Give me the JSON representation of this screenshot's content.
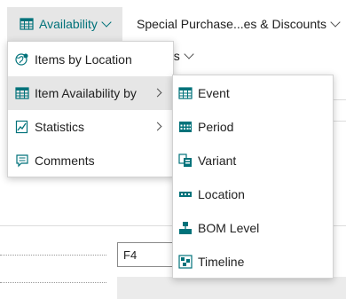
{
  "colors": {
    "accent": "#00727a",
    "menu_highlight": "#e6e6e6",
    "icon": "#00727a"
  },
  "action_bar": {
    "availability_label": "Availability",
    "availability_icon": "grid-table-icon",
    "special_label": "Special Purchase...es & Discounts",
    "hidden_fragment": "es"
  },
  "availability_menu": {
    "items": [
      {
        "label": "Items by Location",
        "icon": "globe-location-icon"
      },
      {
        "label": "Item Availability by",
        "icon": "grid-table-icon",
        "has_submenu": true
      },
      {
        "label": "Statistics",
        "icon": "statistics-chart-icon",
        "has_submenu": true
      },
      {
        "label": "Comments",
        "icon": "comment-icon"
      }
    ]
  },
  "availability_by_submenu": {
    "items": [
      {
        "label": "Event",
        "icon": "grid-table-icon"
      },
      {
        "label": "Period",
        "icon": "calendar-grid-icon"
      },
      {
        "label": "Variant",
        "icon": "variant-icon"
      },
      {
        "label": "Location",
        "icon": "location-bar-icon"
      },
      {
        "label": "BOM Level",
        "icon": "bom-level-icon"
      },
      {
        "label": "Timeline",
        "icon": "timeline-icon"
      }
    ]
  },
  "background_form": {
    "field_value": "F4"
  }
}
